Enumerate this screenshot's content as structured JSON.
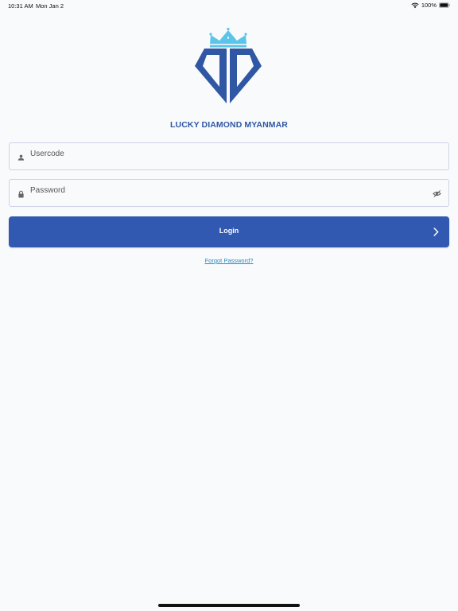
{
  "status_bar": {
    "time": "10:31 AM",
    "date": "Mon Jan 2",
    "battery": "100%",
    "wifi_icon": "wifi-icon",
    "battery_icon": "battery-icon"
  },
  "brand": {
    "name": "LUCKY DIAMOND MYANMAR",
    "logo_icon": "diamond-crown-logo",
    "primary_color": "#2f57a3",
    "crown_color": "#5bc4e8"
  },
  "form": {
    "usercode": {
      "placeholder": "Usercode",
      "value": "",
      "icon": "user-icon"
    },
    "password": {
      "placeholder": "Password",
      "value": "",
      "icon": "lock-icon",
      "toggle_icon": "eye-off-icon"
    },
    "login_label": "Login",
    "login_icon": "chevron-right-icon",
    "forgot_label": "Forgot Password?",
    "button_color": "#3159b1",
    "link_color": "#2a8ac4"
  }
}
